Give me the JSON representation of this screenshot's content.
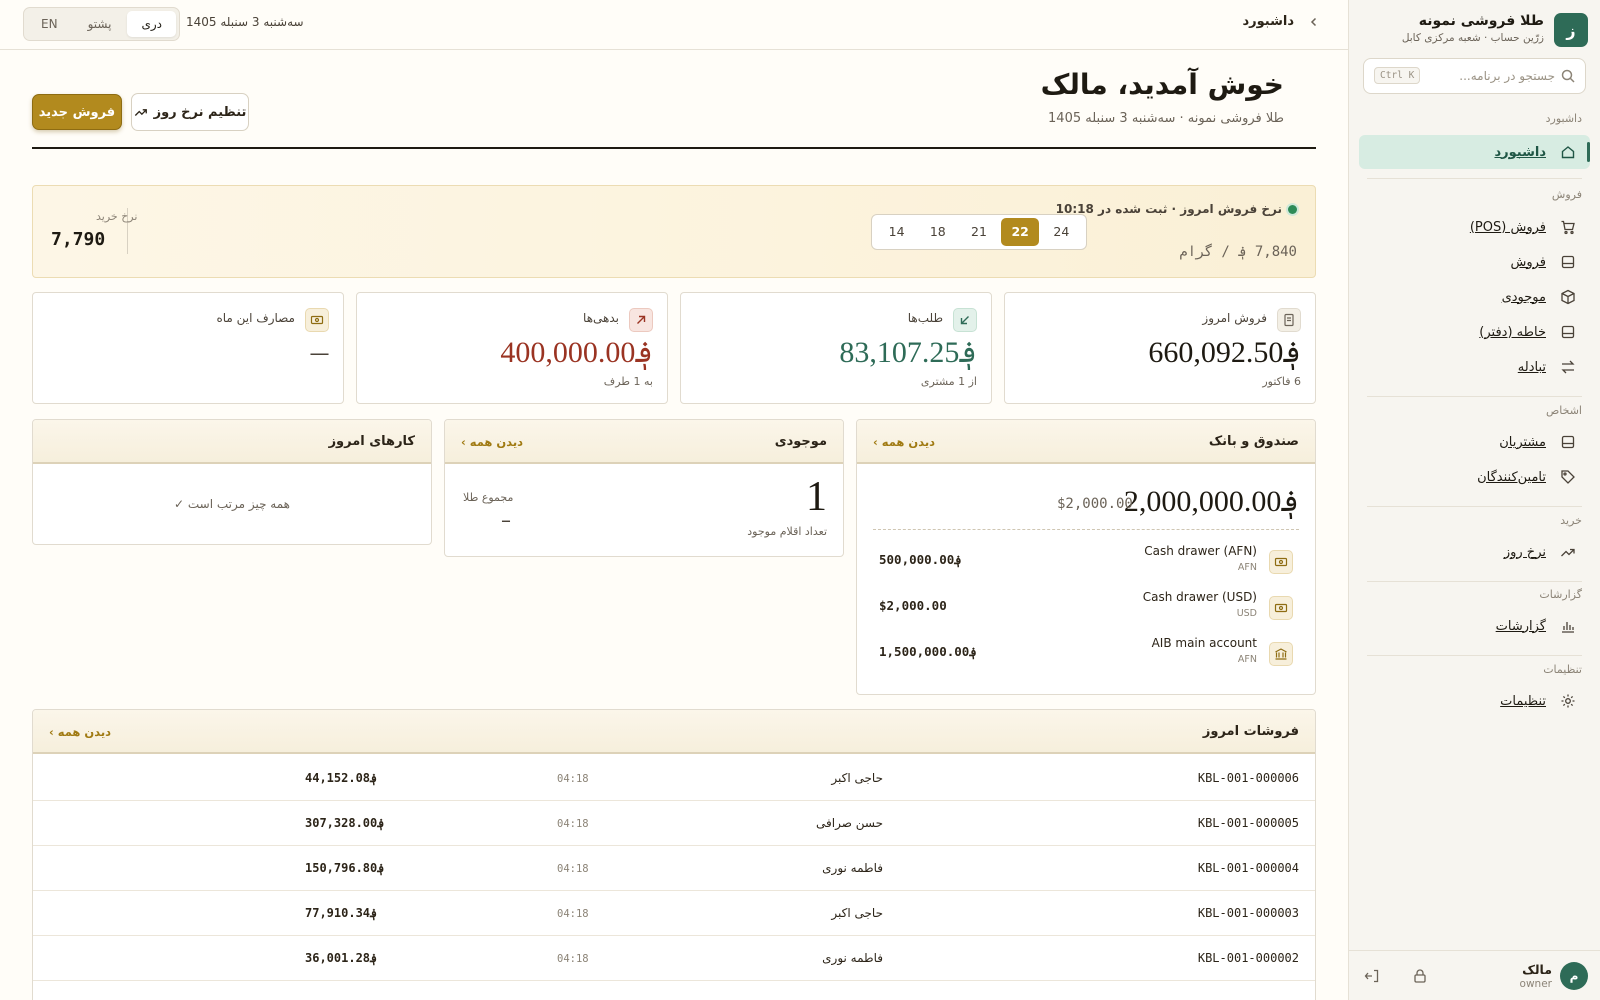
{
  "sidebar": {
    "brand_letter": "ز",
    "brand_name": "طلا فروشی نمونه",
    "brand_sub": "زرّین حساب · شعبه مرکزی کابل",
    "search_placeholder": "جستجو در برنامه...",
    "search_shortcut": "Ctrl K",
    "sections": {
      "dashboard": "داشبورد",
      "sales": "فروش",
      "people": "اشخاص",
      "rates": "خرید",
      "reports": "گزارشات",
      "settings": "تنظیمات"
    },
    "items": {
      "dashboard": "داشبورد",
      "pos": "فروش (POS)",
      "sales": "فروش",
      "inventory": "موجودی",
      "ledger": "خاطه (دفتر)",
      "exchange": "تبادله",
      "customers": "مشتریان",
      "suppliers": "تامین‌کنندگان",
      "daily_rate": "نرخ روز",
      "reports": "گزارشات",
      "settings": "تنظیمات"
    },
    "user": {
      "initial": "م",
      "name": "مالک",
      "role": "owner"
    }
  },
  "topbar": {
    "languages": [
      "دری",
      "پشتو",
      "EN"
    ],
    "active_language": "دری",
    "date": "سه‌شنبه 3 سنبله 1405",
    "breadcrumb": "داشبورد"
  },
  "header": {
    "greeting": "خوش آمدید، مالک",
    "subtitle": "طلا فروشی نمونه · سه‌شنبه 3 سنبله 1405",
    "new_sale": "فروش جدید",
    "set_rate": "تنظیم نرخ روز"
  },
  "rate": {
    "label": "نرخ فروش امروز · ثبت شده در 10:18",
    "value": "7,840 ؋ / گرام",
    "karats": [
      "24",
      "22",
      "21",
      "18",
      "14"
    ],
    "active_karat": "22",
    "buy_label": "نرخ خرید",
    "buy_value": "7,790"
  },
  "stats": {
    "today_sales": {
      "label": "فروش امروز",
      "value": "؋660,092.50",
      "sub": "6 فاکتور"
    },
    "receivables": {
      "label": "طلب‌ها",
      "value": "؋83,107.25",
      "sub": "از 1 مشتری"
    },
    "debts": {
      "label": "بدهی‌ها",
      "value": "؋400,000.00",
      "sub": "به 1 طرف"
    },
    "expenses": {
      "label": "مصارف این ماه",
      "value": "—",
      "sub": ""
    }
  },
  "colors": {
    "accent": "#b28a1e",
    "brand": "#2e6b57",
    "positive": "#2e6b57",
    "negative": "#9a3322"
  },
  "cash": {
    "title": "صندوق و بانک",
    "view_all": "دیدن همه ›",
    "total_afn": "؋2,000,000.00",
    "total_usd": "$2,000.00",
    "accounts": [
      {
        "name": "Cash drawer (AFN)",
        "cur": "AFN",
        "amount": "؋500,000.00",
        "icon": "cash-icon"
      },
      {
        "name": "Cash drawer (USD)",
        "cur": "USD",
        "amount": "$2,000.00",
        "icon": "cash-icon"
      },
      {
        "name": "AIB main account",
        "cur": "AFN",
        "amount": "؋1,500,000.00",
        "icon": "bank-icon"
      }
    ]
  },
  "inventory": {
    "title": "موجودی",
    "view_all": "دیدن همه ›",
    "count": "1",
    "count_label": "تعداد اقلام موجود",
    "gold_label": "مجموع طلا",
    "gold_value": "–"
  },
  "tasks": {
    "title": "کارهای امروز",
    "empty": "همه چیز مرتب است ✓"
  },
  "sales_today": {
    "title": "فروشات امروز",
    "view_all": "دیدن همه ›",
    "rows": [
      {
        "id": "KBL-001-000006",
        "customer": "حاجی اکبر",
        "time": "04:18",
        "amount": "؋44,152.08"
      },
      {
        "id": "KBL-001-000005",
        "customer": "حسن صرافی",
        "time": "04:18",
        "amount": "؋307,328.00"
      },
      {
        "id": "KBL-001-000004",
        "customer": "فاطمه نوری",
        "time": "04:18",
        "amount": "؋150,796.80"
      },
      {
        "id": "KBL-001-000003",
        "customer": "حاجی اکبر",
        "time": "04:18",
        "amount": "؋77,910.34"
      },
      {
        "id": "KBL-001-000002",
        "customer": "فاطمه نوری",
        "time": "04:18",
        "amount": "؋36,001.28"
      }
    ]
  }
}
